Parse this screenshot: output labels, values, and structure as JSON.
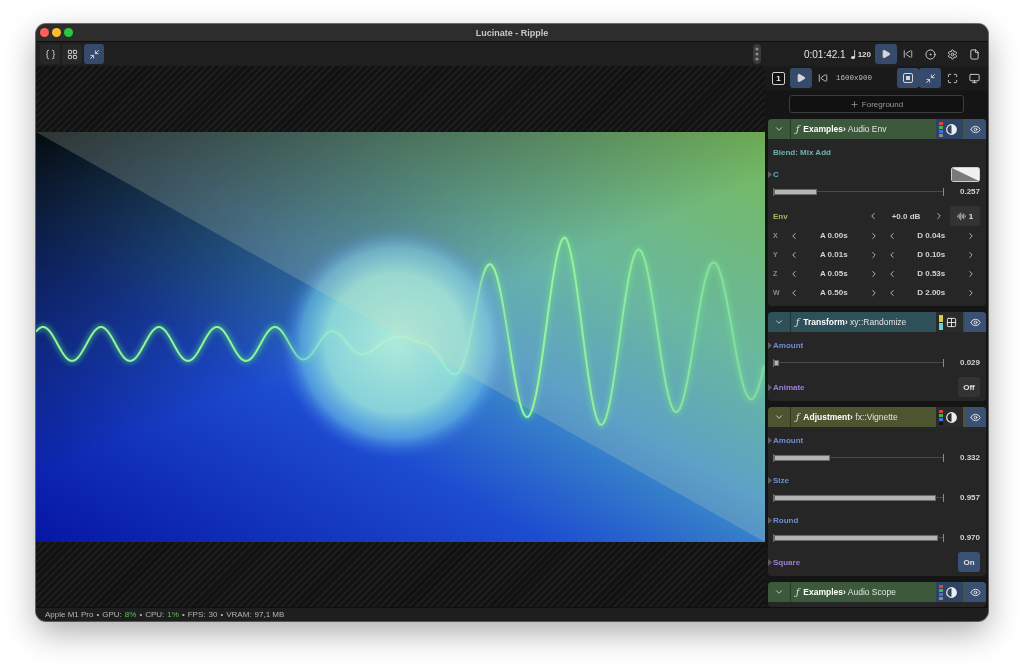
{
  "window": {
    "title": "Lucinate - Ripple"
  },
  "view_toolbar": [
    {
      "kind": "code",
      "selected": false
    },
    {
      "kind": "grid",
      "selected": false
    },
    {
      "kind": "shrink",
      "selected": true
    }
  ],
  "transport": {
    "time": "0:01:42.1",
    "tempo": "120",
    "controls": [
      {
        "kind": "play",
        "selected": true
      },
      {
        "kind": "rewind",
        "selected": false
      },
      {
        "kind": "record",
        "selected": false
      },
      {
        "kind": "settings",
        "selected": false
      },
      {
        "kind": "file",
        "selected": false
      }
    ]
  },
  "preview_bar": {
    "screen": "1",
    "playback": [
      {
        "kind": "play",
        "selected": true
      },
      {
        "kind": "rewind",
        "selected": false
      }
    ],
    "resolution": "1600x900",
    "view": [
      {
        "kind": "fit",
        "selected": true
      },
      {
        "kind": "shrink",
        "selected": true
      },
      {
        "kind": "fullscreen",
        "selected": false
      },
      {
        "kind": "monitor",
        "selected": false
      }
    ]
  },
  "add_layer": {
    "label": "Foreground"
  },
  "layers": [
    {
      "glyph": "ƒ",
      "title": "**Examples›** Audio Env",
      "color": "#3c5a3b",
      "expanded": true,
      "swatches": [
        {
          "color": "#d64545"
        },
        {
          "color": "#4cb04c"
        },
        {
          "color": "#3f6fe0"
        },
        {
          "color": "#8a8a8a"
        }
      ],
      "mode": {
        "kind": "contrast",
        "active": true
      },
      "visible": true,
      "params": [
        {
          "kind": "blend",
          "label": "Blend: Mix Add"
        },
        {
          "kind": "color",
          "label": "C",
          "level": 0.257,
          "reading": "0.257"
        },
        {
          "kind": "env",
          "label": "Env",
          "gain": "+0.0 dB",
          "channel": "1",
          "axes": [
            {
              "label": "X",
              "attack": "A 0.00s",
              "decay": "D 0.04s"
            },
            {
              "label": "Y",
              "attack": "A 0.01s",
              "decay": "D 0.10s"
            },
            {
              "label": "Z",
              "attack": "A 0.05s",
              "decay": "D 0.53s"
            },
            {
              "label": "W",
              "attack": "A 0.50s",
              "decay": "D 2.00s"
            }
          ]
        }
      ]
    },
    {
      "glyph": "ƒ",
      "title": "**Transform›** xy::Randomize",
      "color": "#2e5058",
      "expanded": true,
      "swatches": [
        {
          "color": "#d8cc4a"
        },
        {
          "color": "#6cd0cc"
        }
      ],
      "mode": {
        "kind": "grid",
        "active": false
      },
      "visible": true,
      "params": [
        {
          "kind": "slider",
          "label": "Amount",
          "level": 0.029,
          "reading": "0.029"
        },
        {
          "kind": "toggle",
          "label": "Animate",
          "value": "Off",
          "on": false
        }
      ]
    },
    {
      "glyph": "ƒ",
      "title": "**Adjustment›** fx::Vignette",
      "color": "#4d5430",
      "expanded": true,
      "swatches": [
        {
          "color": "#d64545"
        },
        {
          "color": "#4cb04c"
        },
        {
          "color": "#3f6fe0"
        },
        {
          "color": "#111111"
        }
      ],
      "mode": {
        "kind": "contrast",
        "active": false
      },
      "visible": true,
      "params": [
        {
          "kind": "slider",
          "label": "Amount",
          "level": 0.332,
          "reading": "0.332"
        },
        {
          "kind": "slider",
          "label": "Size",
          "level": 0.957,
          "reading": "0.957"
        },
        {
          "kind": "slider",
          "label": "Round",
          "level": 0.97,
          "reading": "0.970"
        },
        {
          "kind": "toggle",
          "label": "Square",
          "value": "On",
          "on": true
        }
      ]
    },
    {
      "glyph": "ƒ",
      "title": "**Examples›** Audio Scope",
      "color": "#3c5a3b",
      "expanded": true,
      "swatches": [
        {
          "color": "#d64545"
        },
        {
          "color": "#4cb04c"
        },
        {
          "color": "#3f6fe0"
        },
        {
          "color": "#8a8a8a"
        }
      ],
      "mode": {
        "kind": "contrast",
        "active": true
      },
      "visible": true
    }
  ],
  "status_bar": {
    "items": [
      {
        "label": "Apple M1 Pro"
      },
      {
        "separator": "•",
        "label": "GPU:",
        "value": "8%",
        "highlight": true
      },
      {
        "separator": "•",
        "label": "CPU:",
        "value": "1%",
        "highlight": true
      },
      {
        "separator": "•",
        "label": "FPS:",
        "value": "30",
        "highlight": false
      },
      {
        "separator": "•",
        "label": "VRAM:",
        "value": "97,1 MB",
        "highlight": false
      }
    ]
  }
}
